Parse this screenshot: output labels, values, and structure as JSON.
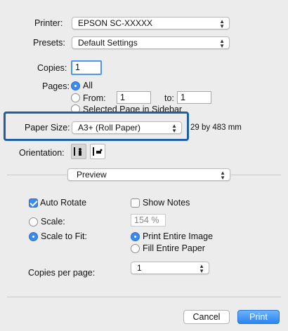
{
  "printer": {
    "label": "Printer:",
    "value": "EPSON SC-XXXXX"
  },
  "presets": {
    "label": "Presets:",
    "value": "Default Settings"
  },
  "copies": {
    "label": "Copies:",
    "value": "1"
  },
  "pages": {
    "label": "Pages:",
    "all": "All",
    "from_label": "From:",
    "from_value": "1",
    "to_label": "to:",
    "to_value": "1",
    "selected": "Selected Page in Sidebar"
  },
  "paper_size": {
    "label": "Paper Size:",
    "value": "A3+ (Roll Paper)",
    "dimensions": "29 by 483 mm"
  },
  "orientation": {
    "label": "Orientation:"
  },
  "section": {
    "value": "Preview"
  },
  "options": {
    "auto_rotate": "Auto Rotate",
    "auto_rotate_checked": true,
    "show_notes": "Show Notes",
    "show_notes_checked": false,
    "scale": "Scale:",
    "scale_value": "154 %",
    "scale_to_fit": "Scale to Fit:",
    "print_entire_image": "Print Entire Image",
    "fill_entire_paper": "Fill Entire Paper"
  },
  "copies_per_page": {
    "label": "Copies per page:",
    "value": "1"
  },
  "buttons": {
    "cancel": "Cancel",
    "print": "Print"
  },
  "colors": {
    "accent": "#3a8bf0",
    "highlight_border": "#1f5fa8",
    "background": "#ececec"
  }
}
